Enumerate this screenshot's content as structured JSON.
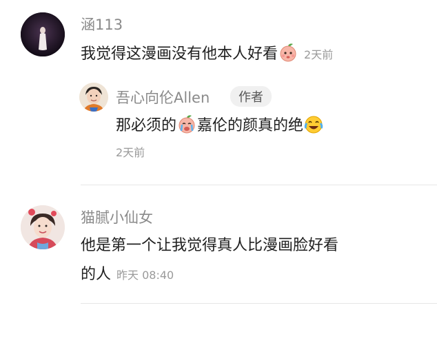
{
  "comments": [
    {
      "username": "涵113",
      "text": "我觉得这漫画没有他本人好看",
      "emoji": "peach-face-emoji",
      "time": "2天前",
      "reply": {
        "username": "吾心向伦Allen",
        "badge": "作者",
        "text_before": "那必须的",
        "emoji_1": "crying-face-emoji",
        "text_after": "嘉伦的颜真的绝",
        "emoji_2": "laughing-tears-emoji",
        "time": "2天前"
      }
    },
    {
      "username": "猫腻小仙女",
      "text_line1": "他是第一个让我觉得真人比漫画脸好看",
      "text_line2": "的人",
      "time": "昨天 08:40"
    }
  ],
  "colors": {
    "username": "#8a8a8a",
    "time": "#9a9a9a",
    "divider": "#e6e6e6",
    "badge_bg": "#f0f0f0"
  }
}
